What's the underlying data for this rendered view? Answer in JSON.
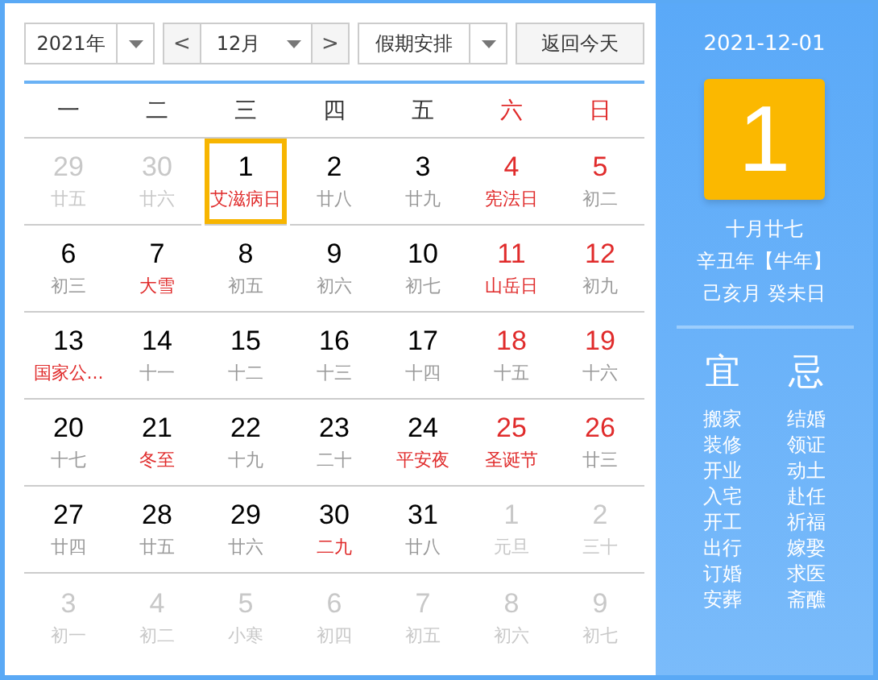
{
  "toolbar": {
    "year": "2021年",
    "prev": "<",
    "month": "12月",
    "next": ">",
    "holiday_select": "假期安排",
    "today_button": "返回今天"
  },
  "weekdays": [
    {
      "label": "一",
      "weekend": false
    },
    {
      "label": "二",
      "weekend": false
    },
    {
      "label": "三",
      "weekend": false
    },
    {
      "label": "四",
      "weekend": false
    },
    {
      "label": "五",
      "weekend": false
    },
    {
      "label": "六",
      "weekend": true
    },
    {
      "label": "日",
      "weekend": true
    }
  ],
  "days": [
    {
      "day": "29",
      "lunar": "廿五",
      "outside": true,
      "selected": false
    },
    {
      "day": "30",
      "lunar": "廿六",
      "outside": true,
      "selected": false
    },
    {
      "day": "1",
      "lunar": "艾滋病日",
      "outside": false,
      "holiday": false,
      "festival": true,
      "selected": true
    },
    {
      "day": "2",
      "lunar": "廿八",
      "outside": false,
      "holiday": false,
      "festival": false,
      "selected": false
    },
    {
      "day": "3",
      "lunar": "廿九",
      "outside": false,
      "holiday": false,
      "festival": false,
      "selected": false
    },
    {
      "day": "4",
      "lunar": "宪法日",
      "outside": false,
      "holiday": true,
      "festival": true,
      "selected": false
    },
    {
      "day": "5",
      "lunar": "初二",
      "outside": false,
      "holiday": true,
      "festival": false,
      "selected": false
    },
    {
      "day": "6",
      "lunar": "初三",
      "outside": false,
      "holiday": false,
      "festival": false,
      "selected": false
    },
    {
      "day": "7",
      "lunar": "大雪",
      "outside": false,
      "holiday": false,
      "festival": true,
      "selected": false
    },
    {
      "day": "8",
      "lunar": "初五",
      "outside": false,
      "holiday": false,
      "festival": false,
      "selected": false
    },
    {
      "day": "9",
      "lunar": "初六",
      "outside": false,
      "holiday": false,
      "festival": false,
      "selected": false
    },
    {
      "day": "10",
      "lunar": "初七",
      "outside": false,
      "holiday": false,
      "festival": false,
      "selected": false
    },
    {
      "day": "11",
      "lunar": "山岳日",
      "outside": false,
      "holiday": true,
      "festival": true,
      "selected": false
    },
    {
      "day": "12",
      "lunar": "初九",
      "outside": false,
      "holiday": true,
      "festival": false,
      "selected": false
    },
    {
      "day": "13",
      "lunar": "国家公...",
      "outside": false,
      "holiday": false,
      "festival": true,
      "selected": false
    },
    {
      "day": "14",
      "lunar": "十一",
      "outside": false,
      "holiday": false,
      "festival": false,
      "selected": false
    },
    {
      "day": "15",
      "lunar": "十二",
      "outside": false,
      "holiday": false,
      "festival": false,
      "selected": false
    },
    {
      "day": "16",
      "lunar": "十三",
      "outside": false,
      "holiday": false,
      "festival": false,
      "selected": false
    },
    {
      "day": "17",
      "lunar": "十四",
      "outside": false,
      "holiday": false,
      "festival": false,
      "selected": false
    },
    {
      "day": "18",
      "lunar": "十五",
      "outside": false,
      "holiday": true,
      "festival": false,
      "selected": false
    },
    {
      "day": "19",
      "lunar": "十六",
      "outside": false,
      "holiday": true,
      "festival": false,
      "selected": false
    },
    {
      "day": "20",
      "lunar": "十七",
      "outside": false,
      "holiday": false,
      "festival": false,
      "selected": false
    },
    {
      "day": "21",
      "lunar": "冬至",
      "outside": false,
      "holiday": false,
      "festival": true,
      "selected": false
    },
    {
      "day": "22",
      "lunar": "十九",
      "outside": false,
      "holiday": false,
      "festival": false,
      "selected": false
    },
    {
      "day": "23",
      "lunar": "二十",
      "outside": false,
      "holiday": false,
      "festival": false,
      "selected": false
    },
    {
      "day": "24",
      "lunar": "平安夜",
      "outside": false,
      "holiday": false,
      "festival": true,
      "selected": false
    },
    {
      "day": "25",
      "lunar": "圣诞节",
      "outside": false,
      "holiday": true,
      "festival": true,
      "selected": false
    },
    {
      "day": "26",
      "lunar": "廿三",
      "outside": false,
      "holiday": true,
      "festival": false,
      "selected": false
    },
    {
      "day": "27",
      "lunar": "廿四",
      "outside": false,
      "holiday": false,
      "festival": false,
      "selected": false
    },
    {
      "day": "28",
      "lunar": "廿五",
      "outside": false,
      "holiday": false,
      "festival": false,
      "selected": false
    },
    {
      "day": "29",
      "lunar": "廿六",
      "outside": false,
      "holiday": false,
      "festival": false,
      "selected": false
    },
    {
      "day": "30",
      "lunar": "二九",
      "outside": false,
      "holiday": false,
      "festival": true,
      "selected": false
    },
    {
      "day": "31",
      "lunar": "廿八",
      "outside": false,
      "holiday": false,
      "festival": false,
      "selected": false
    },
    {
      "day": "1",
      "lunar": "元旦",
      "outside": true,
      "selected": false
    },
    {
      "day": "2",
      "lunar": "三十",
      "outside": true,
      "selected": false
    },
    {
      "day": "3",
      "lunar": "初一",
      "outside": true,
      "selected": false
    },
    {
      "day": "4",
      "lunar": "初二",
      "outside": true,
      "selected": false
    },
    {
      "day": "5",
      "lunar": "小寒",
      "outside": true,
      "selected": false
    },
    {
      "day": "6",
      "lunar": "初四",
      "outside": true,
      "selected": false
    },
    {
      "day": "7",
      "lunar": "初五",
      "outside": true,
      "selected": false
    },
    {
      "day": "8",
      "lunar": "初六",
      "outside": true,
      "selected": false
    },
    {
      "day": "9",
      "lunar": "初七",
      "outside": true,
      "selected": false
    }
  ],
  "detail": {
    "date": "2021-12-01",
    "big_day": "1",
    "lunar_date": "十月廿七",
    "year_name": "辛丑年【牛年】",
    "ganzhi": "己亥月 癸未日",
    "good_title": "宜",
    "good": [
      "搬家",
      "装修",
      "开业",
      "入宅",
      "开工",
      "出行",
      "订婚",
      "安葬"
    ],
    "bad_title": "忌",
    "bad": [
      "结婚",
      "领证",
      "动土",
      "赴任",
      "祈福",
      "嫁娶",
      "求医",
      "斋醮"
    ]
  }
}
